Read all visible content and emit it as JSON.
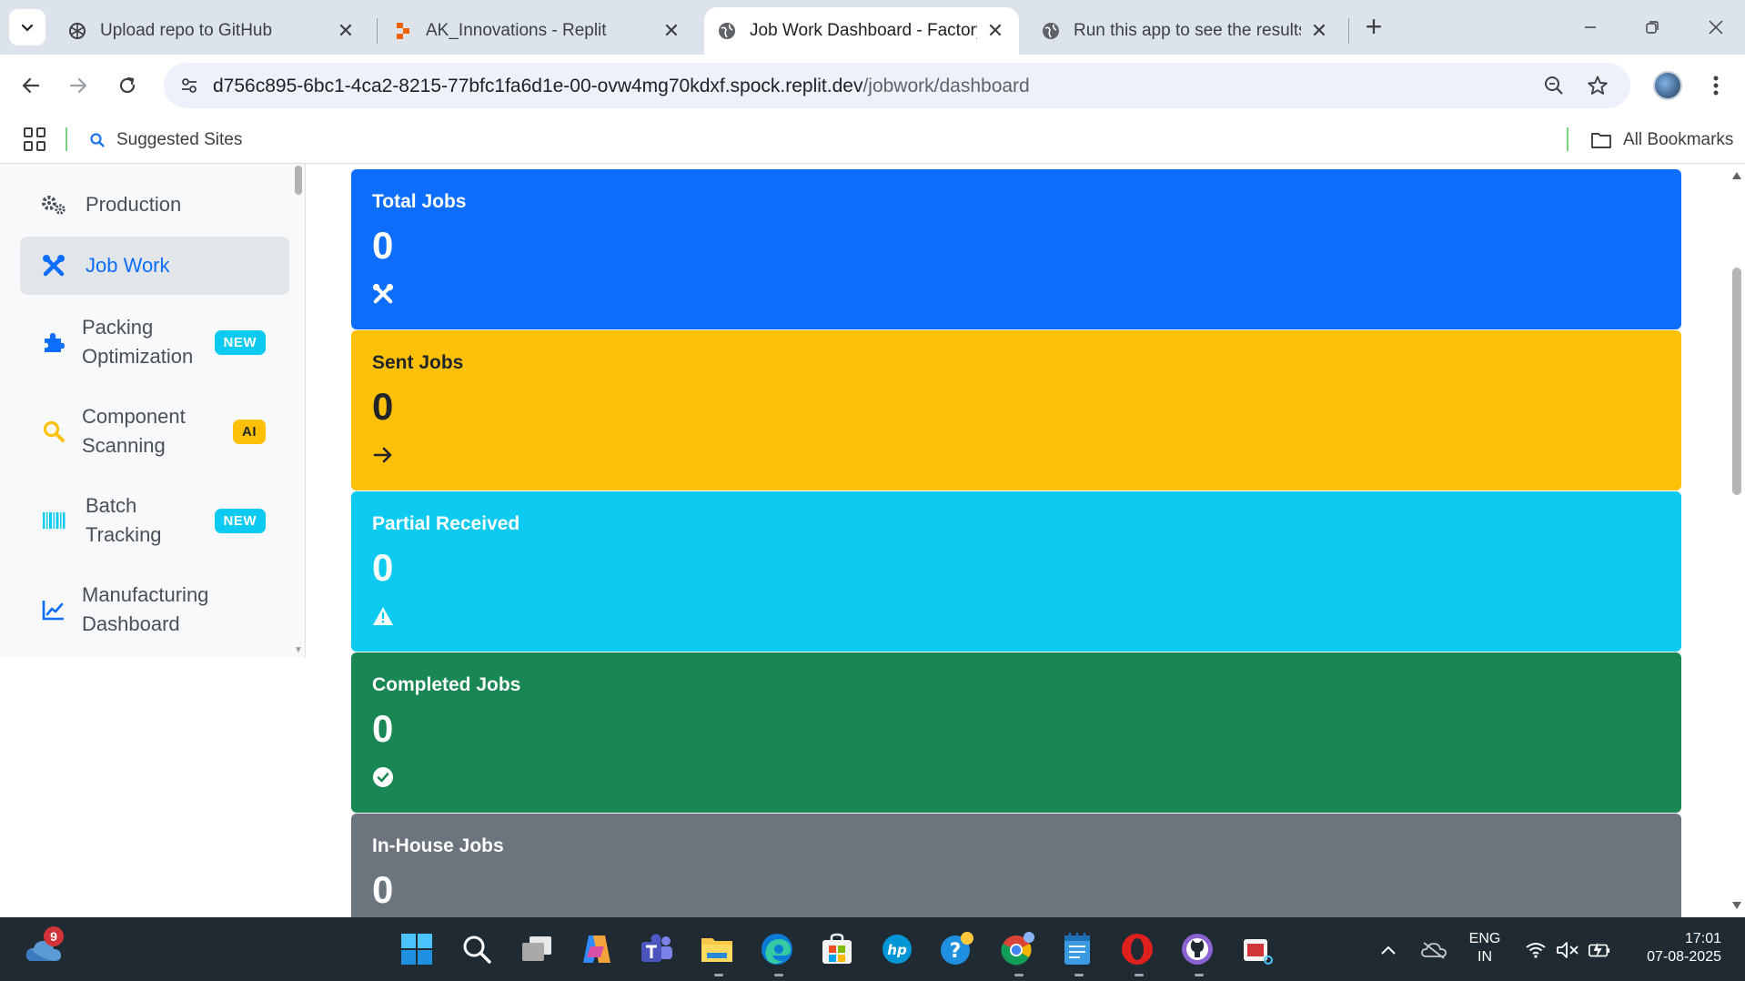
{
  "browser": {
    "tabs": [
      {
        "title": "Upload repo to GitHub",
        "icon": "openai-icon",
        "active": false
      },
      {
        "title": "AK_Innovations - Replit",
        "icon": "replit-icon",
        "active": false
      },
      {
        "title": "Job Work Dashboard - Factory I",
        "icon": "globe-icon",
        "active": true
      },
      {
        "title": "Run this app to see the results I",
        "icon": "globe-icon",
        "active": false
      }
    ],
    "url_host": "d756c895-6bc1-4ca2-8215-77bfc1fa6d1e-00-ovw4mg70kdxf.spock.replit.dev",
    "url_path": "/jobwork/dashboard",
    "bookmarks": {
      "suggested_sites": "Suggested Sites",
      "all_bookmarks": "All Bookmarks"
    }
  },
  "sidebar": {
    "items": [
      {
        "label": "Production",
        "icon": "gears-icon",
        "badge": ""
      },
      {
        "label": "Job Work",
        "icon": "tools-icon",
        "badge": "",
        "active": true
      },
      {
        "label": "Packing Optimization",
        "icon": "puzzle-icon",
        "badge": "NEW"
      },
      {
        "label": "Component Scanning",
        "icon": "search-icon",
        "badge": "AI"
      },
      {
        "label": "Batch Tracking",
        "icon": "barcode-icon",
        "badge": "NEW"
      },
      {
        "label": "Manufacturing Dashboard",
        "icon": "chart-line-icon",
        "badge": ""
      }
    ]
  },
  "cards": [
    {
      "title": "Total Jobs",
      "value": "0",
      "icon": "tools-icon",
      "bg": "#0d6efd",
      "fg": "#ffffff"
    },
    {
      "title": "Sent Jobs",
      "value": "0",
      "icon": "arrow-right-icon",
      "bg": "#ffc107",
      "fg": "#212529"
    },
    {
      "title": "Partial Received",
      "value": "0",
      "icon": "warning-icon",
      "bg": "#0dcaf0",
      "fg": "#ffffff"
    },
    {
      "title": "Completed Jobs",
      "value": "0",
      "icon": "check-circle-icon",
      "bg": "#198754",
      "fg": "#ffffff"
    },
    {
      "title": "In-House Jobs",
      "value": "0",
      "icon": "",
      "bg": "#6c757d",
      "fg": "#ffffff"
    }
  ],
  "taskbar": {
    "notification_count": "9",
    "language": "ENG",
    "region": "IN",
    "time": "17:01",
    "date": "07-08-2025"
  }
}
